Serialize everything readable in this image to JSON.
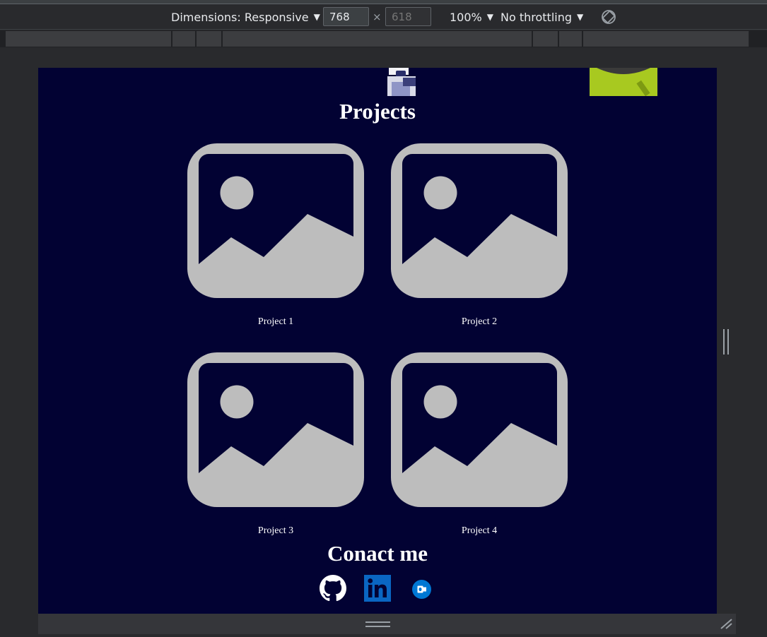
{
  "devtools": {
    "dimensions_label": "Dimensions: Responsive",
    "width_value": "768",
    "height_placeholder": "618",
    "times": "×",
    "zoom_label": "100%",
    "throttle_label": "No throttling",
    "caret": "▼"
  },
  "page": {
    "projects_title": "Projects",
    "projects": [
      {
        "caption": "Project 1",
        "icon": "image-placeholder-icon"
      },
      {
        "caption": "Project 2",
        "icon": "image-placeholder-icon"
      },
      {
        "caption": "Project 3",
        "icon": "image-placeholder-icon"
      },
      {
        "caption": "Project 4",
        "icon": "image-placeholder-icon"
      }
    ],
    "contact_title": "Conact me",
    "social_links": [
      {
        "name": "github",
        "icon": "github-icon"
      },
      {
        "name": "linkedin",
        "icon": "linkedin-icon"
      },
      {
        "name": "outlook",
        "icon": "outlook-icon"
      }
    ]
  },
  "colors": {
    "page_background": "#020233",
    "placeholder_gray": "#bdbdbd",
    "linkedin_blue": "#0a66c2",
    "outlook_blue": "#0078d4",
    "devtools_dark": "#292a2d"
  }
}
